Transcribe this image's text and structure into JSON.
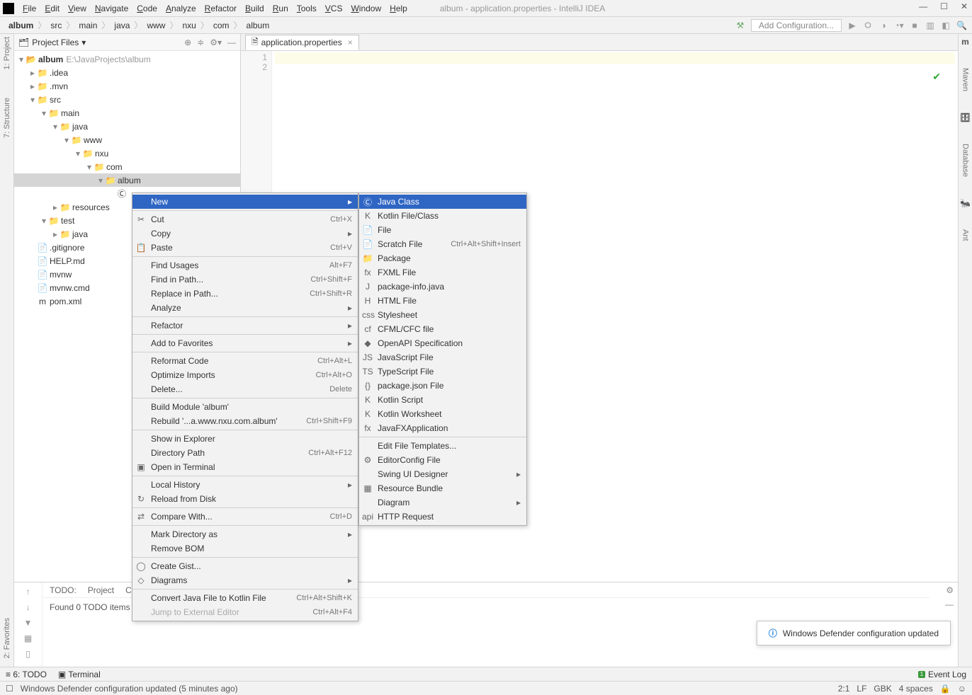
{
  "window": {
    "title": "album - application.properties - IntelliJ IDEA"
  },
  "menubar": [
    "File",
    "Edit",
    "View",
    "Navigate",
    "Code",
    "Analyze",
    "Refactor",
    "Build",
    "Run",
    "Tools",
    "VCS",
    "Window",
    "Help"
  ],
  "breadcrumb": [
    "album",
    "src",
    "main",
    "java",
    "www",
    "nxu",
    "com",
    "album"
  ],
  "toolbar": {
    "addconfig": "Add Configuration..."
  },
  "projectpane": {
    "title": "Project Files",
    "root": {
      "name": "album",
      "path": "E:\\JavaProjects\\album"
    },
    "nodes": [
      {
        "depth": 1,
        "tw": "▾",
        "icon": "📁",
        "label": ".idea",
        "twshow": "▸"
      },
      {
        "depth": 1,
        "tw": "▸",
        "icon": "📁",
        "label": ".mvn"
      },
      {
        "depth": 1,
        "tw": "▾",
        "icon": "📁",
        "label": "src"
      },
      {
        "depth": 2,
        "tw": "▾",
        "icon": "📁",
        "label": "main"
      },
      {
        "depth": 3,
        "tw": "▾",
        "icon": "📁",
        "label": "java"
      },
      {
        "depth": 4,
        "tw": "▾",
        "icon": "📁",
        "label": "www"
      },
      {
        "depth": 5,
        "tw": "▾",
        "icon": "📁",
        "label": "nxu"
      },
      {
        "depth": 6,
        "tw": "▾",
        "icon": "📁",
        "label": "com"
      },
      {
        "depth": 7,
        "tw": "▾",
        "icon": "📁",
        "label": "album",
        "sel": true
      },
      {
        "depth": 8,
        "tw": " ",
        "icon": "Ⓒ",
        "label": ""
      },
      {
        "depth": 3,
        "tw": "▸",
        "icon": "📁",
        "label": "resources"
      },
      {
        "depth": 2,
        "tw": "▾",
        "icon": "📁",
        "label": "test"
      },
      {
        "depth": 3,
        "tw": "▸",
        "icon": "📁",
        "label": "java"
      },
      {
        "depth": 1,
        "tw": " ",
        "icon": "📄",
        "label": ".gitignore"
      },
      {
        "depth": 1,
        "tw": " ",
        "icon": "📄",
        "label": "HELP.md"
      },
      {
        "depth": 1,
        "tw": " ",
        "icon": "📄",
        "label": "mvnw"
      },
      {
        "depth": 1,
        "tw": " ",
        "icon": "📄",
        "label": "mvnw.cmd"
      },
      {
        "depth": 1,
        "tw": " ",
        "icon": "m",
        "label": "pom.xml"
      }
    ]
  },
  "editor": {
    "tab": "application.properties",
    "lines": [
      "1",
      "2"
    ]
  },
  "leftGutterLabels": {
    "project": "1: Project",
    "structure": "7: Structure"
  },
  "rightGutterLabels": {
    "maven": "Maven",
    "database": "Database",
    "ant": "Ant"
  },
  "favoritesLabel": "2: Favorites",
  "todo": {
    "label": "TODO:",
    "tabs": [
      "Project",
      "Current Fi"
    ],
    "msg": "Found 0 TODO items in"
  },
  "bottombar": {
    "todo": "6: TODO",
    "terminal": "Terminal",
    "eventlog": "Event Log"
  },
  "statusbar": {
    "msg": "Windows Defender configuration updated (5 minutes ago)",
    "pos": "2:1",
    "le": "LF",
    "enc": "GBK",
    "indent": "4 spaces"
  },
  "toast": "Windows Defender configuration updated",
  "ctx1": [
    {
      "t": "mi",
      "icon": "",
      "label": "New",
      "arrow": "▸",
      "hl": true
    },
    {
      "t": "sep"
    },
    {
      "t": "mi",
      "icon": "✂",
      "label": "Cut",
      "sc": "Ctrl+X"
    },
    {
      "t": "mi",
      "icon": "",
      "label": "Copy",
      "arrow": "▸"
    },
    {
      "t": "mi",
      "icon": "📋",
      "label": "Paste",
      "sc": "Ctrl+V"
    },
    {
      "t": "sep"
    },
    {
      "t": "mi",
      "icon": "",
      "label": "Find Usages",
      "sc": "Alt+F7"
    },
    {
      "t": "mi",
      "icon": "",
      "label": "Find in Path...",
      "sc": "Ctrl+Shift+F"
    },
    {
      "t": "mi",
      "icon": "",
      "label": "Replace in Path...",
      "sc": "Ctrl+Shift+R"
    },
    {
      "t": "mi",
      "icon": "",
      "label": "Analyze",
      "arrow": "▸"
    },
    {
      "t": "sep"
    },
    {
      "t": "mi",
      "icon": "",
      "label": "Refactor",
      "arrow": "▸"
    },
    {
      "t": "sep"
    },
    {
      "t": "mi",
      "icon": "",
      "label": "Add to Favorites",
      "arrow": "▸"
    },
    {
      "t": "sep"
    },
    {
      "t": "mi",
      "icon": "",
      "label": "Reformat Code",
      "sc": "Ctrl+Alt+L"
    },
    {
      "t": "mi",
      "icon": "",
      "label": "Optimize Imports",
      "sc": "Ctrl+Alt+O"
    },
    {
      "t": "mi",
      "icon": "",
      "label": "Delete...",
      "sc": "Delete"
    },
    {
      "t": "sep"
    },
    {
      "t": "mi",
      "icon": "",
      "label": "Build Module 'album'"
    },
    {
      "t": "mi",
      "icon": "",
      "label": "Rebuild '...a.www.nxu.com.album'",
      "sc": "Ctrl+Shift+F9"
    },
    {
      "t": "sep"
    },
    {
      "t": "mi",
      "icon": "",
      "label": "Show in Explorer"
    },
    {
      "t": "mi",
      "icon": "",
      "label": "Directory Path",
      "sc": "Ctrl+Alt+F12"
    },
    {
      "t": "mi",
      "icon": "▣",
      "label": "Open in Terminal"
    },
    {
      "t": "sep"
    },
    {
      "t": "mi",
      "icon": "",
      "label": "Local History",
      "arrow": "▸"
    },
    {
      "t": "mi",
      "icon": "↻",
      "label": "Reload from Disk"
    },
    {
      "t": "sep"
    },
    {
      "t": "mi",
      "icon": "⇄",
      "label": "Compare With...",
      "sc": "Ctrl+D"
    },
    {
      "t": "sep"
    },
    {
      "t": "mi",
      "icon": "",
      "label": "Mark Directory as",
      "arrow": "▸"
    },
    {
      "t": "mi",
      "icon": "",
      "label": "Remove BOM"
    },
    {
      "t": "sep"
    },
    {
      "t": "mi",
      "icon": "◯",
      "label": "Create Gist..."
    },
    {
      "t": "mi",
      "icon": "◇",
      "label": "Diagrams",
      "arrow": "▸"
    },
    {
      "t": "sep"
    },
    {
      "t": "mi",
      "icon": "",
      "label": "Convert Java File to Kotlin File",
      "sc": "Ctrl+Alt+Shift+K"
    },
    {
      "t": "mi",
      "icon": "",
      "label": "Jump to External Editor",
      "sc": "Ctrl+Alt+F4",
      "disabled": true
    }
  ],
  "ctx2": [
    {
      "t": "mi",
      "icon": "Ⓒ",
      "label": "Java Class",
      "hl": true
    },
    {
      "t": "mi",
      "icon": "K",
      "label": "Kotlin File/Class"
    },
    {
      "t": "mi",
      "icon": "📄",
      "label": "File"
    },
    {
      "t": "mi",
      "icon": "📄",
      "label": "Scratch File",
      "sc": "Ctrl+Alt+Shift+Insert"
    },
    {
      "t": "mi",
      "icon": "📁",
      "label": "Package"
    },
    {
      "t": "mi",
      "icon": "fx",
      "label": "FXML File"
    },
    {
      "t": "mi",
      "icon": "J",
      "label": "package-info.java"
    },
    {
      "t": "mi",
      "icon": "H",
      "label": "HTML File"
    },
    {
      "t": "mi",
      "icon": "css",
      "label": "Stylesheet"
    },
    {
      "t": "mi",
      "icon": "cf",
      "label": "CFML/CFC file"
    },
    {
      "t": "mi",
      "icon": "◆",
      "label": "OpenAPI Specification"
    },
    {
      "t": "mi",
      "icon": "JS",
      "label": "JavaScript File"
    },
    {
      "t": "mi",
      "icon": "TS",
      "label": "TypeScript File"
    },
    {
      "t": "mi",
      "icon": "{}",
      "label": "package.json File"
    },
    {
      "t": "mi",
      "icon": "K",
      "label": "Kotlin Script"
    },
    {
      "t": "mi",
      "icon": "K",
      "label": "Kotlin Worksheet"
    },
    {
      "t": "mi",
      "icon": "fx",
      "label": "JavaFXApplication"
    },
    {
      "t": "sep"
    },
    {
      "t": "mi",
      "icon": "",
      "label": "Edit File Templates..."
    },
    {
      "t": "mi",
      "icon": "⚙",
      "label": "EditorConfig File"
    },
    {
      "t": "mi",
      "icon": "",
      "label": "Swing UI Designer",
      "arrow": "▸"
    },
    {
      "t": "mi",
      "icon": "▦",
      "label": "Resource Bundle"
    },
    {
      "t": "mi",
      "icon": "",
      "label": "Diagram",
      "arrow": "▸"
    },
    {
      "t": "mi",
      "icon": "api",
      "label": "HTTP Request"
    }
  ]
}
